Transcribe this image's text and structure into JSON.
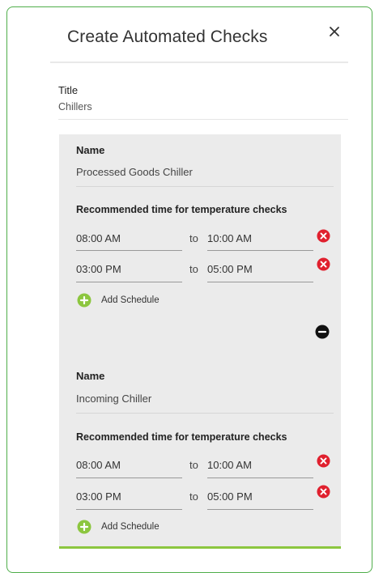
{
  "dialog": {
    "title": "Create Automated Checks",
    "close_icon": "close-icon"
  },
  "form": {
    "title_label": "Title",
    "title_value": "Chillers"
  },
  "colors": {
    "accent_green": "#8cc63f",
    "frame_green": "#4fae4a",
    "remove_red": "#e0202e",
    "card_bg": "#ebebeb"
  },
  "checks": [
    {
      "name_label": "Name",
      "name_value": "Processed Goods Chiller",
      "rec_label": "Recommended time for temperature checks",
      "schedules": [
        {
          "from": "08:00 AM",
          "to_word": "to",
          "to": "10:00 AM"
        },
        {
          "from": "03:00 PM",
          "to_word": "to",
          "to": "05:00 PM"
        }
      ],
      "add_schedule_label": "Add Schedule"
    },
    {
      "name_label": "Name",
      "name_value": "Incoming Chiller",
      "rec_label": "Recommended time for temperature checks",
      "schedules": [
        {
          "from": "08:00 AM",
          "to_word": "to",
          "to": "10:00 AM"
        },
        {
          "from": "03:00 PM",
          "to_word": "to",
          "to": "05:00 PM"
        }
      ],
      "add_schedule_label": "Add Schedule"
    }
  ]
}
